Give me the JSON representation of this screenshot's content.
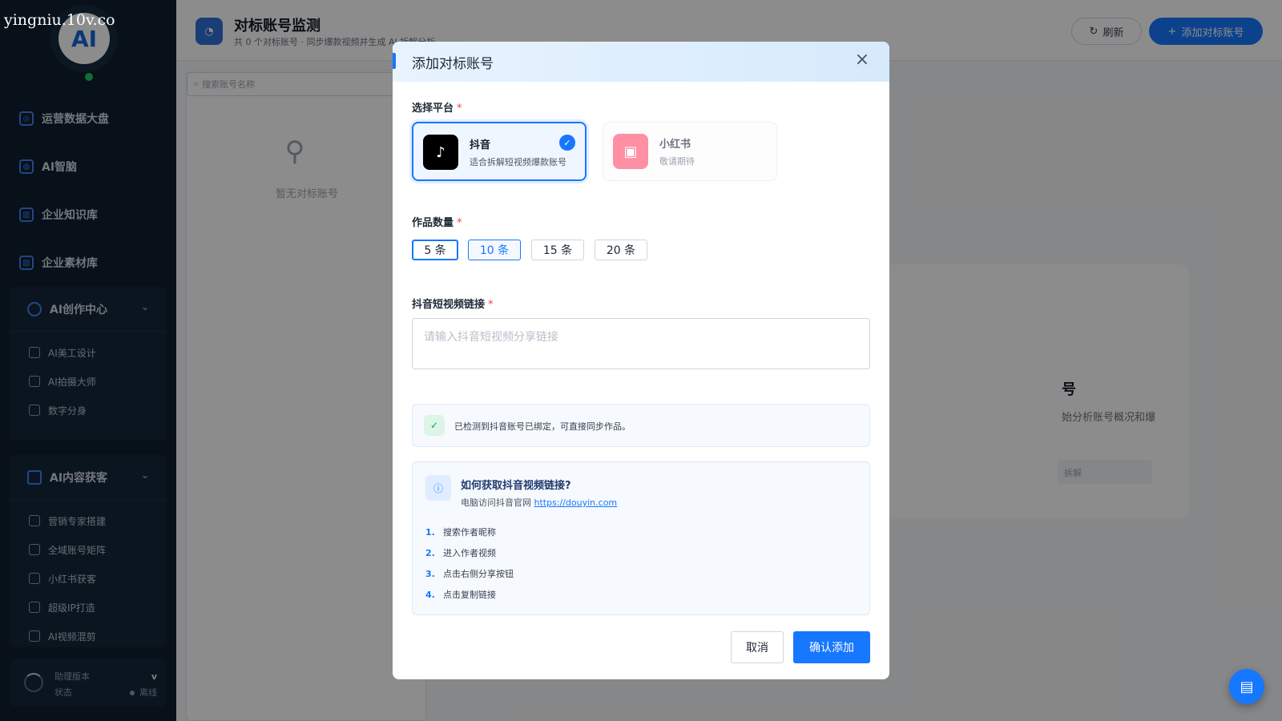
{
  "watermark": "yingniu.10v.co",
  "sidebar": {
    "logo_text": "AI",
    "nav": [
      {
        "label": "运营数据大盘",
        "icon": "dashboard-icon"
      },
      {
        "label": "AI智脑",
        "icon": "brain-icon"
      },
      {
        "label": "企业知识库",
        "icon": "knowledge-base-icon"
      },
      {
        "label": "企业素材库",
        "icon": "image-library-icon"
      }
    ],
    "groups": [
      {
        "label": "AI创作中心",
        "items": [
          "AI美工设计",
          "AI拍摄大师",
          "数字分身"
        ]
      },
      {
        "label": "AI内容获客",
        "items": [
          "营销专家搭建",
          "全域账号矩阵",
          "小红书获客",
          "超级IP打造",
          "AI视频混剪"
        ]
      }
    ],
    "status": {
      "version_label": "助理版本",
      "version_value": "v",
      "state_label": "状态",
      "state_value": "离线"
    }
  },
  "page": {
    "title": "对标账号监测",
    "subtitle": "共 0 个对标账号 · 同步爆款视频并生成 AI 拆解分析",
    "refresh_label": "刷新",
    "add_label": "添加对标账号",
    "search_placeholder": "搜索账号名称",
    "empty_text": "暂无对标账号",
    "right_title_fragment": "号",
    "right_desc_fragment": "始分析账号概况和爆",
    "right_btn_fragment": "拆解"
  },
  "modal": {
    "title": "添加对标账号",
    "platform_label": "选择平台",
    "platforms": [
      {
        "name": "抖音",
        "desc": "适合拆解短视频爆款账号",
        "selected": true,
        "color": "#000000"
      },
      {
        "name": "小红书",
        "desc": "敬请期待",
        "selected": false,
        "color": "#ff8fa3"
      }
    ],
    "count_label": "作品数量",
    "counts": [
      "5 条",
      "10 条",
      "15 条",
      "20 条"
    ],
    "selected_count": "5 条",
    "link_label": "抖音短视频链接",
    "link_placeholder": "请输入抖音短视频分享链接",
    "link_value": "",
    "bind_notice": "已检测到抖音账号已绑定，可直接同步作品。",
    "help": {
      "title": "如何获取抖音视频链接?",
      "sub_prefix": "电脑访问抖音官网",
      "url": "https://douyin.com",
      "steps": [
        {
          "n": "1.",
          "text": "搜索作者昵称"
        },
        {
          "n": "2.",
          "text": "进入作者视频"
        },
        {
          "n": "3.",
          "text": "点击右侧分享按钮"
        },
        {
          "n": "4.",
          "text": "点击复制链接"
        }
      ]
    },
    "cancel_label": "取消",
    "confirm_label": "确认添加"
  },
  "colors": {
    "primary": "#1677ff",
    "sidebar_bg": "#0f1e2e",
    "success": "#16a34a",
    "required": "#ef4444"
  }
}
